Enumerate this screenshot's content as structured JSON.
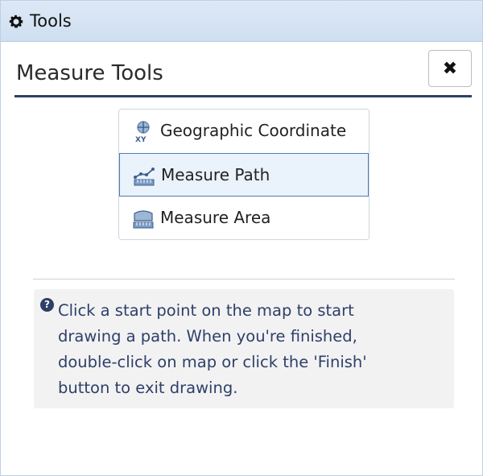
{
  "window": {
    "title": "Tools",
    "icon": "gear-icon"
  },
  "panel": {
    "title": "Measure Tools",
    "close_label": "✖"
  },
  "menu": {
    "items": [
      {
        "label": "Geographic Coordinate",
        "icon": "geographic-coordinate-icon",
        "selected": false
      },
      {
        "label": "Measure Path",
        "icon": "measure-path-icon",
        "selected": true
      },
      {
        "label": "Measure Area",
        "icon": "measure-area-icon",
        "selected": false
      }
    ]
  },
  "help": {
    "icon": "question-circle-icon",
    "text": "Click a start point on the map to start drawing a path. When you're finished, double-click on map or click the 'Finish' button to exit drawing."
  },
  "colors": {
    "titlebar": "#d6e4f4",
    "accent": "#2e3f69",
    "selected_bg": "#eaf2fb",
    "selected_border": "#4f7bb3"
  }
}
